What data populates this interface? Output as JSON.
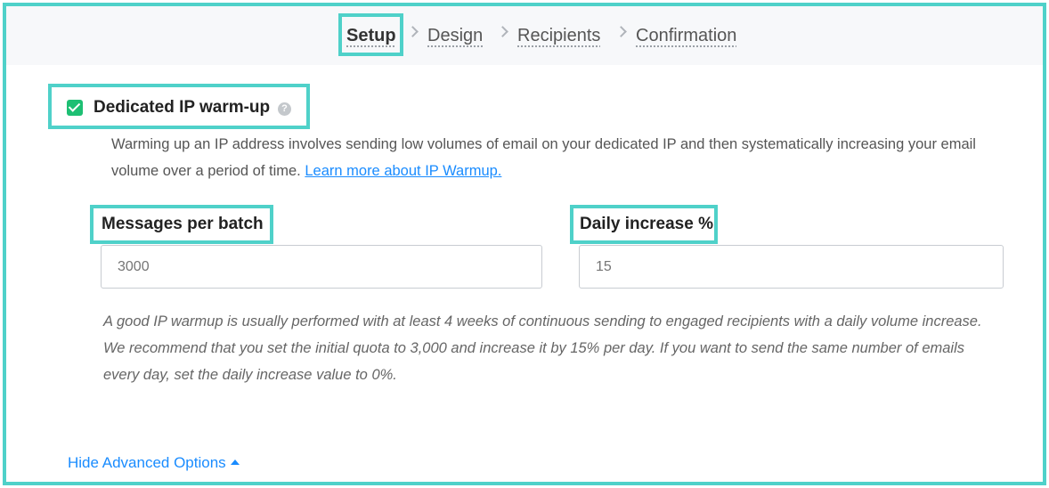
{
  "steps": [
    {
      "label": "Setup",
      "active": true
    },
    {
      "label": "Design",
      "active": false
    },
    {
      "label": "Recipients",
      "active": false
    },
    {
      "label": "Confirmation",
      "active": false
    }
  ],
  "ip_warmup": {
    "checked": true,
    "title": "Dedicated IP warm-up",
    "help_glyph": "?",
    "description": "Warming up an IP address involves sending low volumes of email on your dedicated IP and then systematically increasing your email volume over a period of time. ",
    "learn_more_label": "Learn more about IP Warmup."
  },
  "fields": {
    "messages_per_batch": {
      "label": "Messages per batch",
      "placeholder": "3000",
      "value": ""
    },
    "daily_increase": {
      "label": "Daily increase %",
      "placeholder": "15",
      "value": ""
    }
  },
  "note": "A good IP warmup is usually performed with at least 4 weeks of continuous sending to engaged recipients with a daily volume increase. We recommend that you set the initial quota to 3,000 and increase it by 15% per day. If you want to send the same number of emails every day, set the daily increase value to 0%.",
  "advanced_toggle_label": "Hide Advanced Options",
  "colors": {
    "highlight": "#4fd1c9",
    "checkbox": "#1dbf73",
    "link": "#1a8cff"
  }
}
